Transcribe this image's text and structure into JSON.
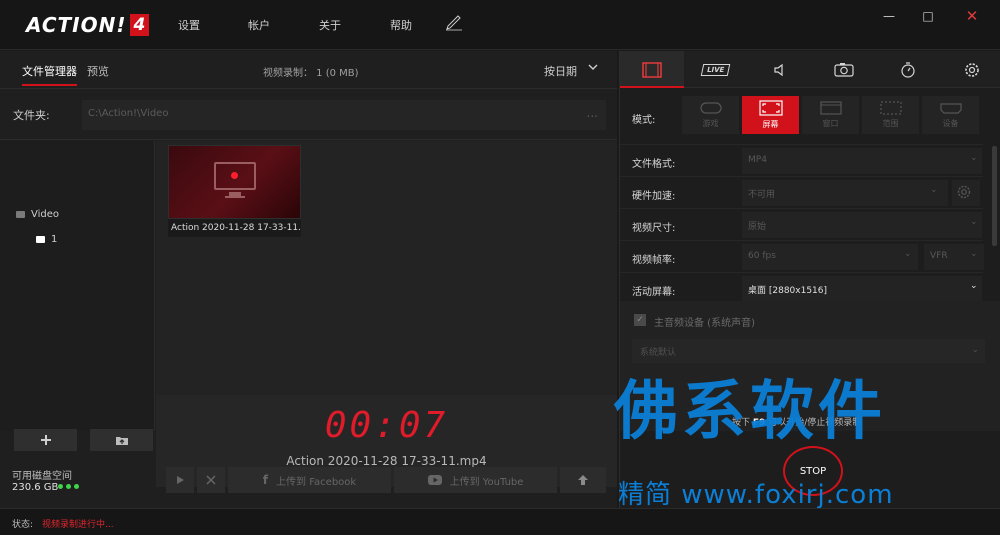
{
  "app": {
    "logo_text": "ACTION!",
    "logo_num": "4",
    "menu": [
      "设置",
      "帐户",
      "关于",
      "帮助"
    ],
    "win_controls": {
      "minimize": "—",
      "maximize": "□",
      "close": "✕"
    }
  },
  "file_manager": {
    "tabs": [
      "文件管理器",
      "预览"
    ],
    "rec_info": "视频录制： 1 (0 MB)",
    "sort_label": "按日期",
    "folder_label": "文件夹:",
    "folder_path": "C:\\Action!\\Video",
    "folder_browse": "...",
    "tree": [
      {
        "label": "Video"
      },
      {
        "label": "1"
      }
    ],
    "file": {
      "name": "Action 2020-11-28 17-33-11.mp4"
    },
    "preview": {
      "timer": "00:07",
      "name": "Action 2020-11-28 17-33-11.mp4"
    },
    "disk": {
      "label": "可用磁盘空间",
      "value": "230.6 GB"
    },
    "actions": {
      "facebook": "上传到 Facebook",
      "youtube": "上传到 YouTube"
    }
  },
  "recorder": {
    "tabs": [
      {
        "id": "video",
        "active": true
      },
      {
        "id": "live",
        "label": "LIVE"
      },
      {
        "id": "audio"
      },
      {
        "id": "screenshot"
      },
      {
        "id": "timer"
      },
      {
        "id": "settings"
      }
    ],
    "mode_label": "模式:",
    "modes": [
      {
        "label": "游戏",
        "active": false
      },
      {
        "label": "屏幕",
        "active": true
      },
      {
        "label": "窗口",
        "active": false
      },
      {
        "label": "范围",
        "active": false
      },
      {
        "label": "设备",
        "active": false
      }
    ],
    "settings": [
      {
        "label": "文件格式:",
        "value": "MP4"
      },
      {
        "label": "硬件加速:",
        "value": "不可用"
      },
      {
        "label": "视频尺寸:",
        "value": "原始"
      },
      {
        "label": "视频帧率:",
        "value": "60 fps",
        "value2": "VFR"
      },
      {
        "label": "活动屏幕:",
        "value": "桌面 [2880x1516]"
      }
    ],
    "audio": {
      "label": "主音频设备 (系统声音)",
      "device": "系统默认"
    },
    "hint": {
      "prefix": "按下",
      "key": "F9",
      "suffix": "可以开始/停止视频录制"
    },
    "stop_label": "STOP"
  },
  "watermark": {
    "big": "佛系软件",
    "small": "精简 www.foxirj.com"
  },
  "status": {
    "label": "状态:",
    "value": "视频录制进行中..."
  },
  "colors": {
    "accent": "#d1121b",
    "disk_ok": "#3fd44a",
    "watermark": "#0b7fd6"
  }
}
